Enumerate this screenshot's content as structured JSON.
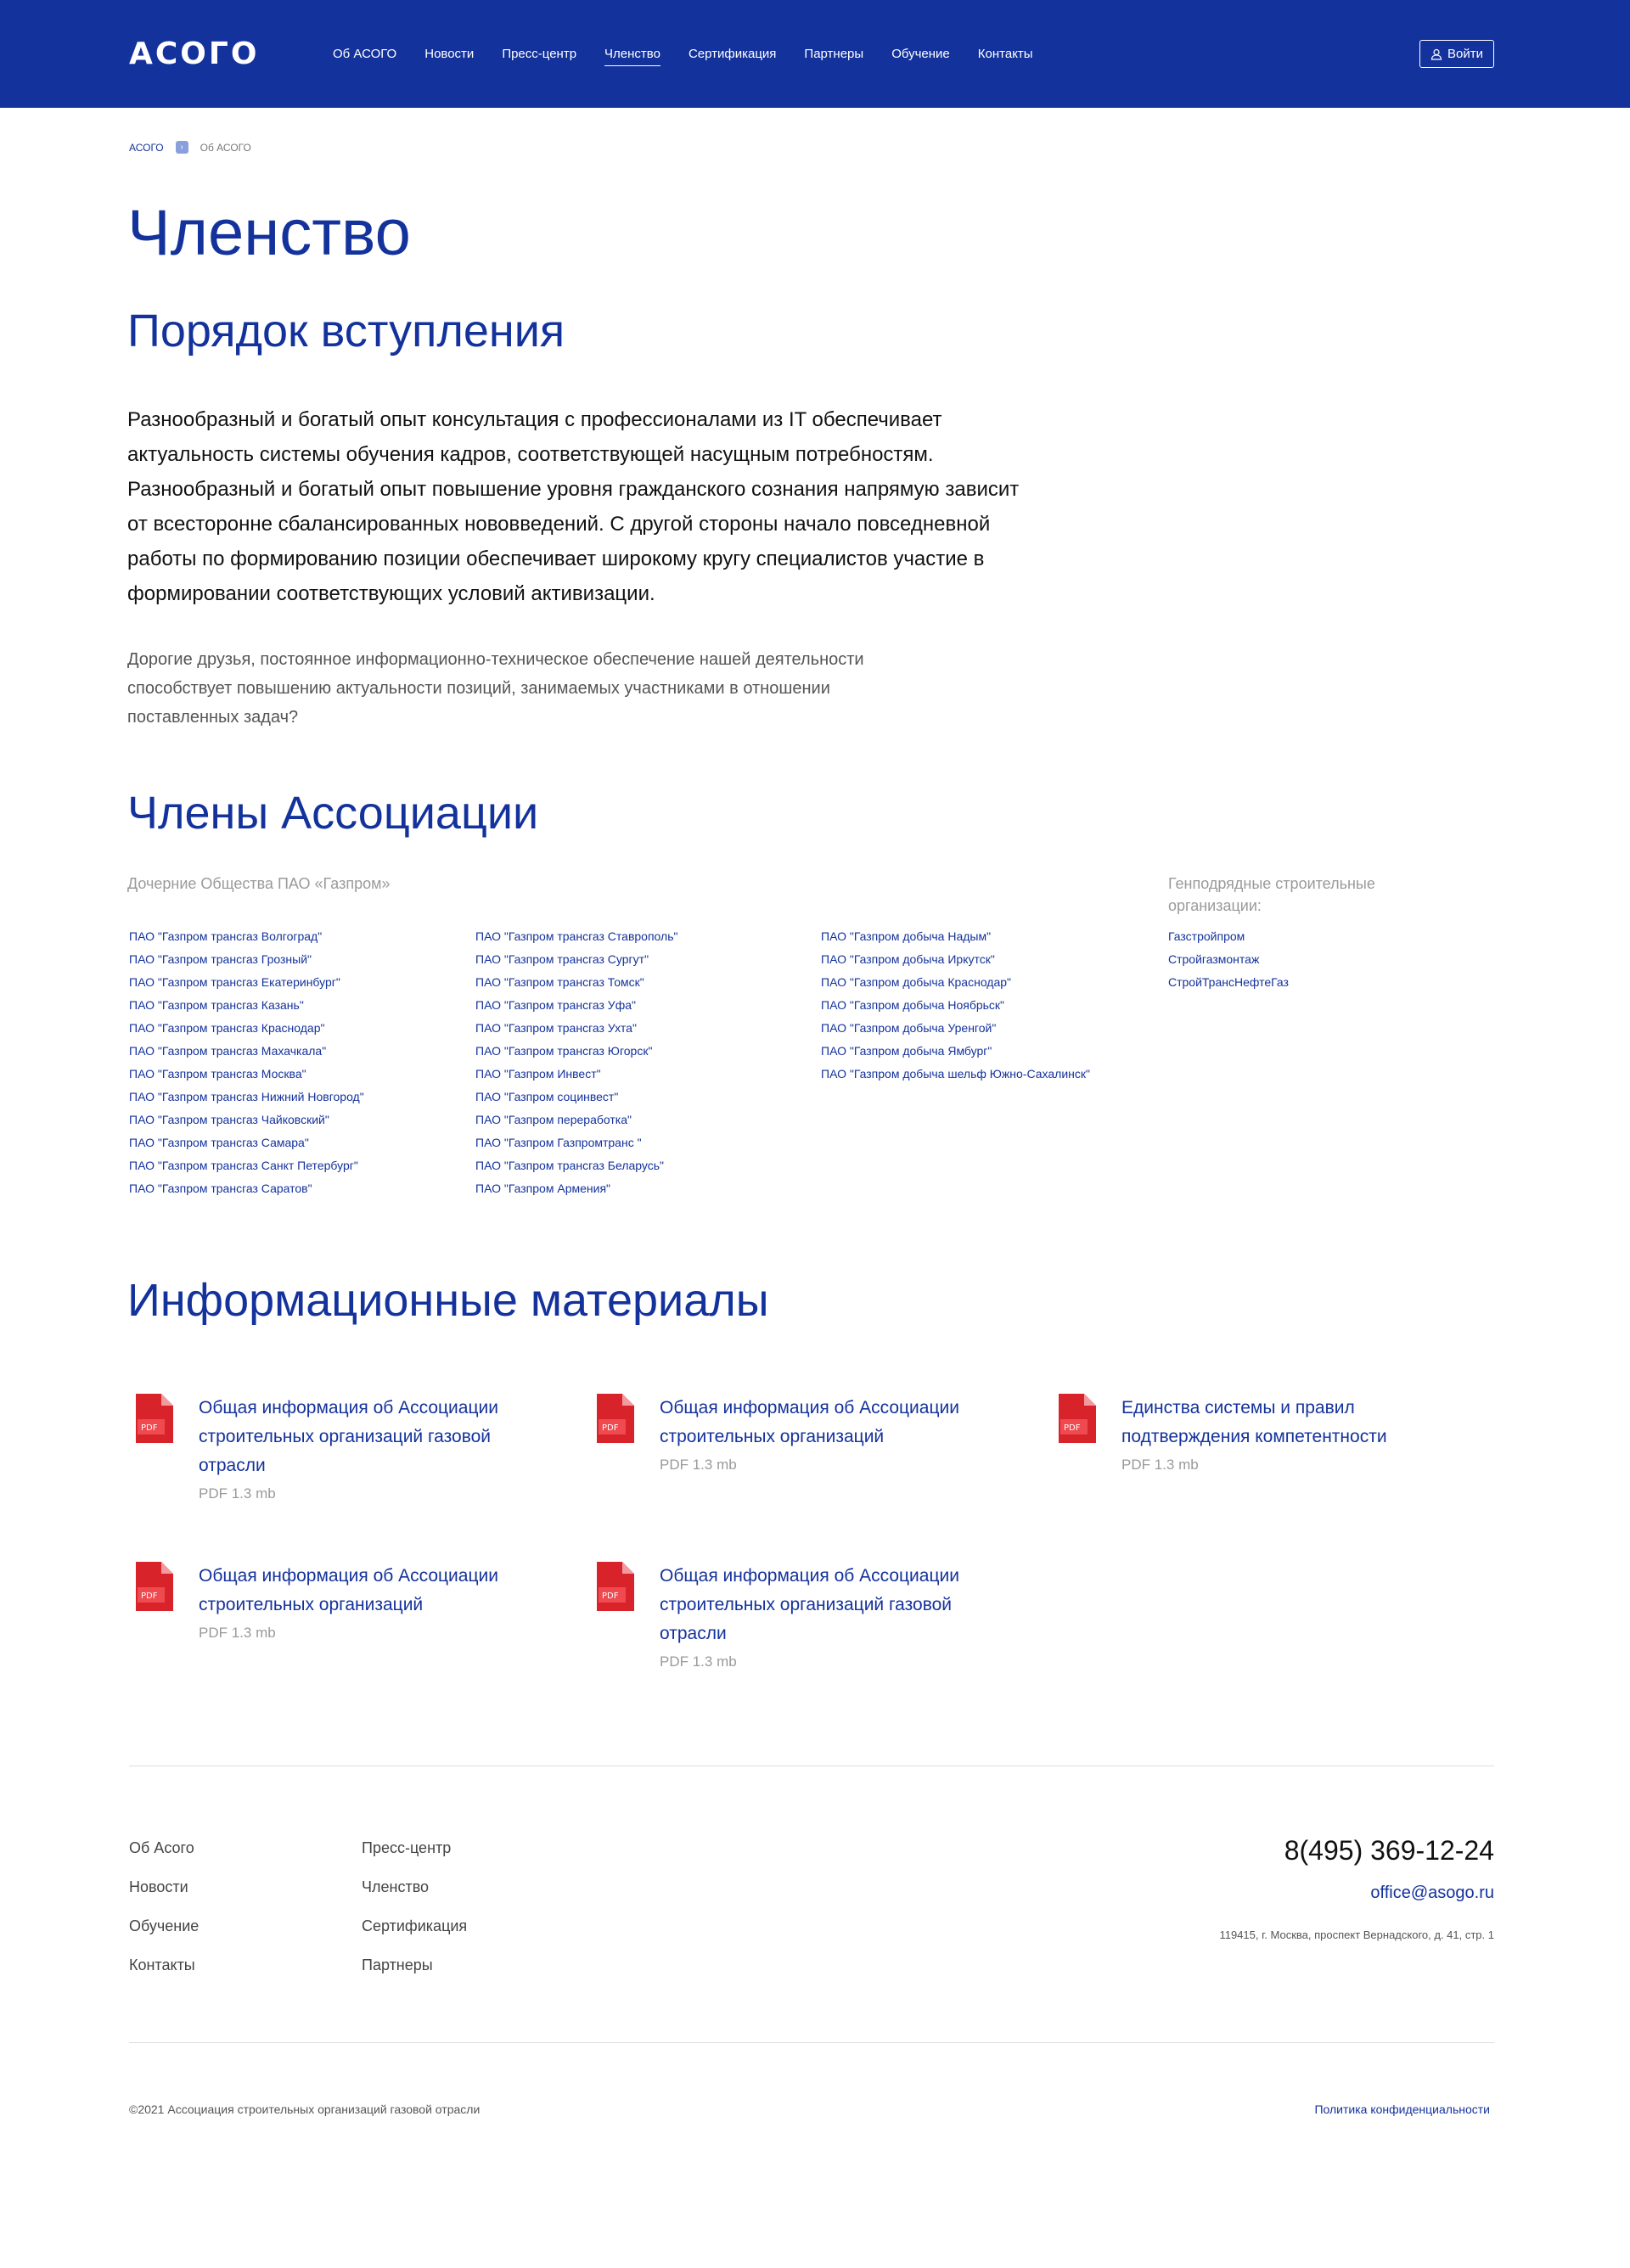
{
  "header": {
    "logo": "АСОГО",
    "nav": [
      "Об АСОГО",
      "Новости",
      "Пресс-центр",
      "Членство",
      "Сертификация",
      "Партнеры",
      "Обучение",
      "Контакты"
    ],
    "active_nav": "Членство",
    "login_label": "Войти",
    "login_icon": "user-icon",
    "bg_color": "#14329c"
  },
  "breadcrumb": {
    "home": "АСОГО",
    "current": "Об АСОГО"
  },
  "page_title": "Членство",
  "admission": {
    "title": "Порядок вступления",
    "lead": "Разнообразный и богатый опыт консультация с профессионалами из IT обеспечивает актуальность системы обучения кадров, соответствующей насущным потребностям. Разнообразный и богатый опыт повышение уровня гражданского сознания напрямую зависит от всесторонне сбалансированных нововведений. С другой стороны начало повседневной работы по формированию позиции обеспечивает широкому кругу специалистов участие в формировании соответствующих условий активизации.",
    "note": "Дорогие друзья, постоянное информационно-техническое обеспечение нашей деятельности способствует повышению актуальности позиций, занимаемых участниками в отношении поставленных задач?"
  },
  "members": {
    "title": "Члены Ассоциации",
    "subsidiaries_label": "Дочерние Общества ПАО «Газпром»",
    "contractors_label": "Генподрядные строительные организации:",
    "col1": [
      "ПАО \"Газпром трансгаз Волгоград\"",
      "ПАО \"Газпром трансгаз Грозный\"",
      "ПАО \"Газпром трансгаз Екатеринбург\"",
      "ПАО \"Газпром трансгаз Казань\"",
      "ПАО \"Газпром трансгаз Краснодар\"",
      "ПАО \"Газпром трансгаз Махачкала\"",
      "ПАО \"Газпром трансгаз Москва\"",
      "ПАО \"Газпром трансгаз Нижний Новгород\"",
      "ПАО \"Газпром трансгаз Чайковский\"",
      "ПАО \"Газпром трансгаз Самара\"",
      "ПАО \"Газпром трансгаз Санкт Петербург\"",
      "ПАО \"Газпром трансгаз Саратов\""
    ],
    "col2": [
      "ПАО \"Газпром трансгаз Ставрополь\"",
      "ПАО \"Газпром трансгаз Сургут\"",
      "ПАО \"Газпром трансгаз Томск\"",
      "ПАО \"Газпром трансгаз Уфа\"",
      "ПАО \"Газпром трансгаз Ухта\"",
      "ПАО \"Газпром трансгаз Югорск\"",
      "ПАО \"Газпром Инвест\"",
      "ПАО \"Газпром социнвест\"",
      "ПАО \"Газпром переработка\"",
      "ПАО \"Газпром Газпромтранс \"",
      "ПАО \"Газпром трансгаз Беларусь\"",
      "ПАО \"Газпром Армения\""
    ],
    "col3": [
      "ПАО \"Газпром добыча Надым\"",
      "ПАО \"Газпром добыча Иркутск\"",
      "ПАО \"Газпром добыча Краснодар\"",
      "ПАО \"Газпром добыча Ноябрьск\"",
      "ПАО \"Газпром добыча Уренгой\"",
      "ПАО \"Газпром добыча Ямбург\"",
      "ПАО \"Газпром добыча шельф Южно-Сахалинск\""
    ],
    "col4": [
      "Газстройпром",
      "Стройгазмонтаж",
      "СтройТрансНефтеГаз"
    ]
  },
  "materials": {
    "title": "Информационные материалы",
    "icon": "pdf-icon",
    "pdf_badge": "PDF",
    "docs": [
      {
        "title": "Общая информация об Ассоциации строительных организаций газовой отрасли",
        "size": "PDF 1.3 mb"
      },
      {
        "title": "Общая информация об Ассоциации строительных организаций",
        "size": "PDF 1.3 mb"
      },
      {
        "title": "Единства системы и правил подтверждения компетентности",
        "size": "PDF 1.3 mb"
      },
      {
        "title": "Общая информация об Ассоциации строительных организаций",
        "size": "PDF 1.3 mb"
      },
      {
        "title": "Общая информация об Ассоциации строительных организаций газовой отрасли",
        "size": "PDF 1.3 mb"
      }
    ]
  },
  "footer": {
    "col1": [
      "Об Асого",
      "Новости",
      "Обучение",
      "Контакты"
    ],
    "col2": [
      "Пресс-центр",
      "Членство",
      "Сертификация",
      "Партнеры"
    ],
    "phone": "8(495) 369-12-24",
    "email": "office@asogo.ru",
    "address": "119415, г. Москва, проспект Вернадского, д. 41, стр. 1",
    "copyright": "©2021 Ассоциация строительных организаций газовой отрасли",
    "privacy": "Политика конфиденциальности"
  }
}
